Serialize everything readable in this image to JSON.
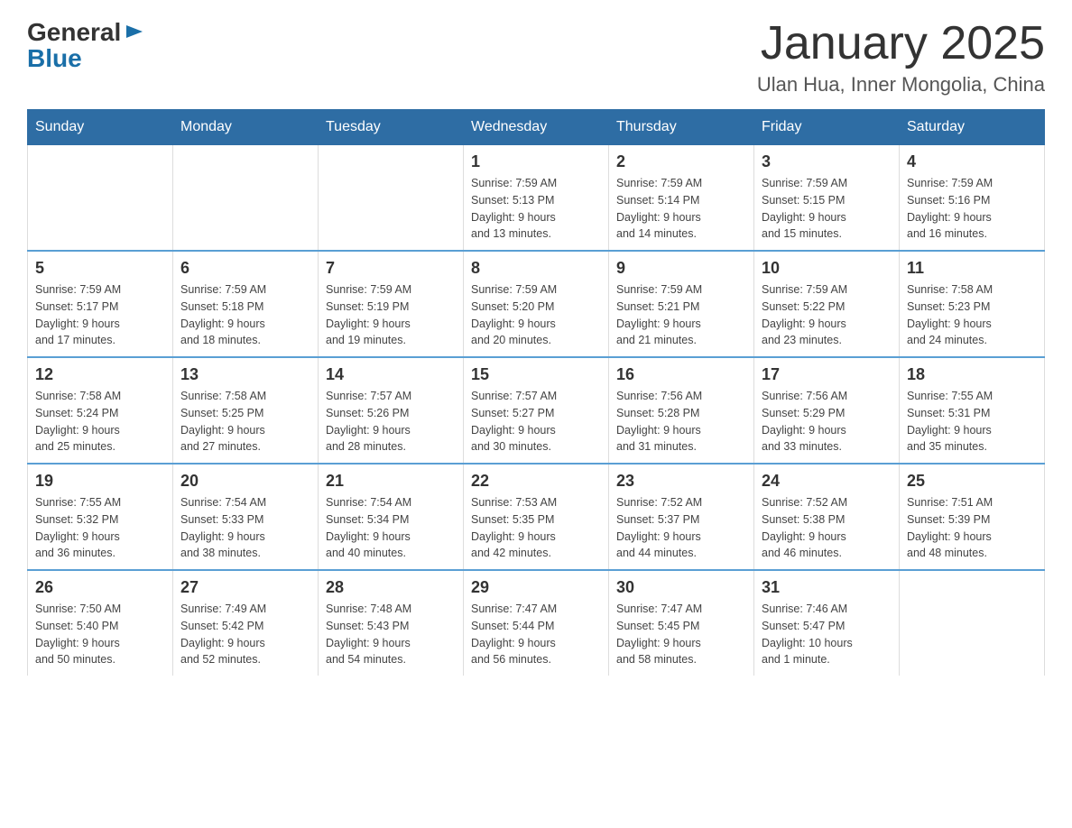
{
  "logo": {
    "general": "General",
    "blue": "Blue"
  },
  "header": {
    "title": "January 2025",
    "location": "Ulan Hua, Inner Mongolia, China"
  },
  "weekdays": [
    "Sunday",
    "Monday",
    "Tuesday",
    "Wednesday",
    "Thursday",
    "Friday",
    "Saturday"
  ],
  "weeks": [
    [
      {
        "day": "",
        "info": ""
      },
      {
        "day": "",
        "info": ""
      },
      {
        "day": "",
        "info": ""
      },
      {
        "day": "1",
        "info": "Sunrise: 7:59 AM\nSunset: 5:13 PM\nDaylight: 9 hours\nand 13 minutes."
      },
      {
        "day": "2",
        "info": "Sunrise: 7:59 AM\nSunset: 5:14 PM\nDaylight: 9 hours\nand 14 minutes."
      },
      {
        "day": "3",
        "info": "Sunrise: 7:59 AM\nSunset: 5:15 PM\nDaylight: 9 hours\nand 15 minutes."
      },
      {
        "day": "4",
        "info": "Sunrise: 7:59 AM\nSunset: 5:16 PM\nDaylight: 9 hours\nand 16 minutes."
      }
    ],
    [
      {
        "day": "5",
        "info": "Sunrise: 7:59 AM\nSunset: 5:17 PM\nDaylight: 9 hours\nand 17 minutes."
      },
      {
        "day": "6",
        "info": "Sunrise: 7:59 AM\nSunset: 5:18 PM\nDaylight: 9 hours\nand 18 minutes."
      },
      {
        "day": "7",
        "info": "Sunrise: 7:59 AM\nSunset: 5:19 PM\nDaylight: 9 hours\nand 19 minutes."
      },
      {
        "day": "8",
        "info": "Sunrise: 7:59 AM\nSunset: 5:20 PM\nDaylight: 9 hours\nand 20 minutes."
      },
      {
        "day": "9",
        "info": "Sunrise: 7:59 AM\nSunset: 5:21 PM\nDaylight: 9 hours\nand 21 minutes."
      },
      {
        "day": "10",
        "info": "Sunrise: 7:59 AM\nSunset: 5:22 PM\nDaylight: 9 hours\nand 23 minutes."
      },
      {
        "day": "11",
        "info": "Sunrise: 7:58 AM\nSunset: 5:23 PM\nDaylight: 9 hours\nand 24 minutes."
      }
    ],
    [
      {
        "day": "12",
        "info": "Sunrise: 7:58 AM\nSunset: 5:24 PM\nDaylight: 9 hours\nand 25 minutes."
      },
      {
        "day": "13",
        "info": "Sunrise: 7:58 AM\nSunset: 5:25 PM\nDaylight: 9 hours\nand 27 minutes."
      },
      {
        "day": "14",
        "info": "Sunrise: 7:57 AM\nSunset: 5:26 PM\nDaylight: 9 hours\nand 28 minutes."
      },
      {
        "day": "15",
        "info": "Sunrise: 7:57 AM\nSunset: 5:27 PM\nDaylight: 9 hours\nand 30 minutes."
      },
      {
        "day": "16",
        "info": "Sunrise: 7:56 AM\nSunset: 5:28 PM\nDaylight: 9 hours\nand 31 minutes."
      },
      {
        "day": "17",
        "info": "Sunrise: 7:56 AM\nSunset: 5:29 PM\nDaylight: 9 hours\nand 33 minutes."
      },
      {
        "day": "18",
        "info": "Sunrise: 7:55 AM\nSunset: 5:31 PM\nDaylight: 9 hours\nand 35 minutes."
      }
    ],
    [
      {
        "day": "19",
        "info": "Sunrise: 7:55 AM\nSunset: 5:32 PM\nDaylight: 9 hours\nand 36 minutes."
      },
      {
        "day": "20",
        "info": "Sunrise: 7:54 AM\nSunset: 5:33 PM\nDaylight: 9 hours\nand 38 minutes."
      },
      {
        "day": "21",
        "info": "Sunrise: 7:54 AM\nSunset: 5:34 PM\nDaylight: 9 hours\nand 40 minutes."
      },
      {
        "day": "22",
        "info": "Sunrise: 7:53 AM\nSunset: 5:35 PM\nDaylight: 9 hours\nand 42 minutes."
      },
      {
        "day": "23",
        "info": "Sunrise: 7:52 AM\nSunset: 5:37 PM\nDaylight: 9 hours\nand 44 minutes."
      },
      {
        "day": "24",
        "info": "Sunrise: 7:52 AM\nSunset: 5:38 PM\nDaylight: 9 hours\nand 46 minutes."
      },
      {
        "day": "25",
        "info": "Sunrise: 7:51 AM\nSunset: 5:39 PM\nDaylight: 9 hours\nand 48 minutes."
      }
    ],
    [
      {
        "day": "26",
        "info": "Sunrise: 7:50 AM\nSunset: 5:40 PM\nDaylight: 9 hours\nand 50 minutes."
      },
      {
        "day": "27",
        "info": "Sunrise: 7:49 AM\nSunset: 5:42 PM\nDaylight: 9 hours\nand 52 minutes."
      },
      {
        "day": "28",
        "info": "Sunrise: 7:48 AM\nSunset: 5:43 PM\nDaylight: 9 hours\nand 54 minutes."
      },
      {
        "day": "29",
        "info": "Sunrise: 7:47 AM\nSunset: 5:44 PM\nDaylight: 9 hours\nand 56 minutes."
      },
      {
        "day": "30",
        "info": "Sunrise: 7:47 AM\nSunset: 5:45 PM\nDaylight: 9 hours\nand 58 minutes."
      },
      {
        "day": "31",
        "info": "Sunrise: 7:46 AM\nSunset: 5:47 PM\nDaylight: 10 hours\nand 1 minute."
      },
      {
        "day": "",
        "info": ""
      }
    ]
  ]
}
